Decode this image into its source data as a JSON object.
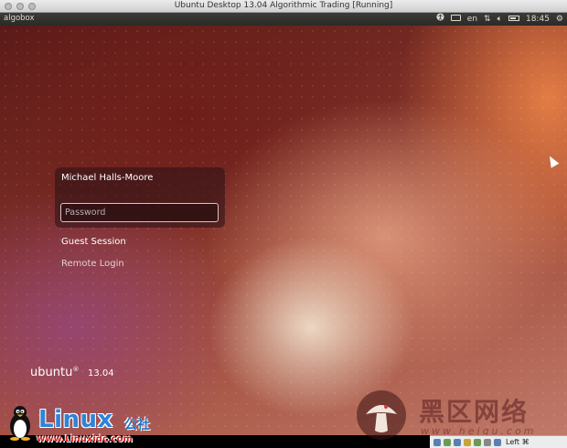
{
  "host_window": {
    "title": "Ubuntu Desktop 13.04 Algorithmic Trading [Running]"
  },
  "panel": {
    "hostname": "algobox",
    "keyboard_layout": "en",
    "clock": "18:45",
    "icons": [
      "accessibility-icon",
      "keyboard-icon",
      "network-icon",
      "volume-icon",
      "battery-icon",
      "gear-icon"
    ]
  },
  "login": {
    "user_name": "Michael Halls-Moore",
    "password_placeholder": "Password",
    "guest_session": "Guest Session",
    "remote_login": "Remote Login"
  },
  "branding": {
    "ubuntu": "ubuntu",
    "registered": "®",
    "version": "13.04"
  },
  "watermarks": {
    "linux_logo": "Linux",
    "linux_cn": "公社",
    "linux_url": "www.Linuxidc.com",
    "heiqu_cn": "黑区网络",
    "heiqu_url": "www.heiqu.com"
  },
  "vbox_status": {
    "host_key": "Left ⌘"
  },
  "colors": {
    "panel_bg": "#3c3b37",
    "wallpaper_dark": "#5a1a18",
    "wallpaper_orange": "#e88046",
    "linux_blue": "#2f84d6",
    "linux_url_red": "#d32222"
  }
}
